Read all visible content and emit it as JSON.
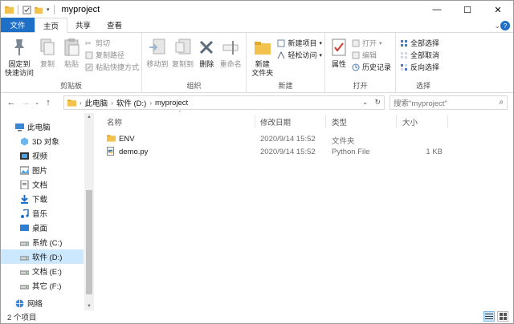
{
  "window": {
    "title": "myproject",
    "minimize": "—",
    "maximize": "☐",
    "close": "✕"
  },
  "ribbon_tabs": [
    "文件",
    "主页",
    "共享",
    "查看"
  ],
  "ribbon": {
    "clipboard": {
      "label": "剪贴板",
      "pin": "固定到\n快速访问",
      "copy": "复制",
      "paste": "粘贴",
      "cut": "剪切",
      "copy_path": "复制路径",
      "paste_shortcut": "粘贴快捷方式"
    },
    "organize": {
      "label": "组织",
      "move_to": "移动到",
      "copy_to": "复制到",
      "delete": "删除",
      "rename": "重命名"
    },
    "new": {
      "label": "新建",
      "new_folder": "新建\n文件夹",
      "new_item": "新建项目",
      "easy_access": "轻松访问"
    },
    "open": {
      "label": "打开",
      "properties": "属性",
      "open": "打开",
      "edit": "编辑",
      "history": "历史记录"
    },
    "select": {
      "label": "选择",
      "select_all": "全部选择",
      "select_none": "全部取消",
      "invert": "反向选择"
    }
  },
  "address": {
    "crumbs": [
      "此电脑",
      "软件 (D:)",
      "myproject"
    ],
    "search_placeholder": "搜索\"myproject\""
  },
  "nav_pane": [
    {
      "label": "此电脑",
      "icon": "computer-icon",
      "indent": 18
    },
    {
      "label": "3D 对象",
      "icon": "3d-objects-icon",
      "indent": 24
    },
    {
      "label": "视频",
      "icon": "video-icon",
      "indent": 24
    },
    {
      "label": "图片",
      "icon": "pictures-icon",
      "indent": 24
    },
    {
      "label": "文档",
      "icon": "documents-icon",
      "indent": 24
    },
    {
      "label": "下载",
      "icon": "downloads-icon",
      "indent": 24
    },
    {
      "label": "音乐",
      "icon": "music-icon",
      "indent": 24
    },
    {
      "label": "桌面",
      "icon": "desktop-icon",
      "indent": 24
    },
    {
      "label": "系统 (C:)",
      "icon": "drive-icon",
      "indent": 24
    },
    {
      "label": "软件 (D:)",
      "icon": "drive-icon",
      "indent": 24,
      "selected": true
    },
    {
      "label": "文档 (E:)",
      "icon": "drive-icon",
      "indent": 24
    },
    {
      "label": "其它 (F:)",
      "icon": "drive-icon",
      "indent": 24
    },
    {
      "label": "网络",
      "icon": "network-icon",
      "indent": 18
    }
  ],
  "columns": {
    "name": "名称",
    "modified": "修改日期",
    "type": "类型",
    "size": "大小"
  },
  "files": [
    {
      "name": "ENV",
      "modified": "2020/9/14 15:52",
      "type": "文件夹",
      "size": "",
      "icon": "folder-icon"
    },
    {
      "name": "demo.py",
      "modified": "2020/9/14 15:52",
      "type": "Python File",
      "size": "1 KB",
      "icon": "python-file-icon"
    }
  ],
  "status": {
    "count": "2 个项目"
  },
  "colors": {
    "file_tab": "#1e6fc6",
    "selection": "#cce8ff",
    "folder": "#f2c14e"
  }
}
